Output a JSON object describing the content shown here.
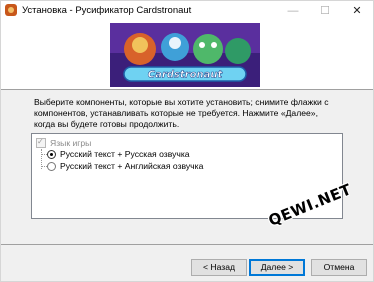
{
  "window": {
    "title": "Установка - Русификатор Cardstronaut",
    "controls": {
      "minimize": "—",
      "maximize": "☐",
      "close": "✕"
    }
  },
  "banner": {
    "logo_text": "Cardstronaut"
  },
  "description": "Выберите компоненты, которые вы хотите установить; снимите флажки с компонентов, устанавливать которые не требуется. Нажмите «Далее», когда вы будете готовы продолжить.",
  "components": {
    "group_label": "Язык игры",
    "options": [
      {
        "label": "Русский текст + Русская озвучка",
        "selected": true
      },
      {
        "label": "Русский текст + Английская озвучка",
        "selected": false
      }
    ]
  },
  "watermark": "QEWI.NET",
  "buttons": {
    "back": "< Назад",
    "next": "Далее >",
    "cancel": "Отмена"
  },
  "colors": {
    "accent": "#0078d7",
    "banner_bg": "#4a2a8c"
  }
}
